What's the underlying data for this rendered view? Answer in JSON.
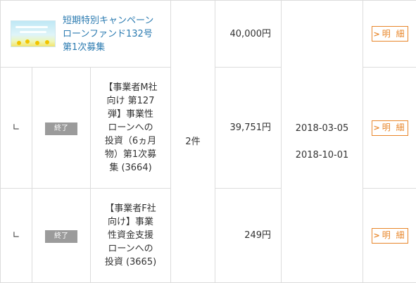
{
  "header_fund": {
    "banner_icon": "campaign-banner-icon",
    "title_lines": [
      "短期特別キャンペーン",
      "ローンファンド132号",
      "第1次募集"
    ],
    "amount": "40,000円",
    "detail_label": "明 細"
  },
  "group": {
    "count": "2件",
    "start_date": "2018-03-05",
    "end_date": "2018-10-01"
  },
  "sub_loans": [
    {
      "marker": "∟",
      "status": "終了",
      "name_lines": [
        "【事業者M社",
        "向け 第127",
        "弾】事業性",
        "ローンへの",
        "投資（6ヵ月",
        "物）第1次募",
        "集 (3664)"
      ],
      "amount": "39,751円",
      "detail_label": "明 細"
    },
    {
      "marker": "∟",
      "status": "終了",
      "name_lines": [
        "【事業者F社",
        "向け】事業",
        "性資金支援",
        "ローンへの",
        "投資 (3665)"
      ],
      "amount": "249円",
      "detail_label": "明 細"
    }
  ],
  "colors": {
    "link": "#2a7ab0",
    "accent": "#e8862a",
    "badge": "#9b9b9b",
    "border": "#dcdcdc"
  }
}
